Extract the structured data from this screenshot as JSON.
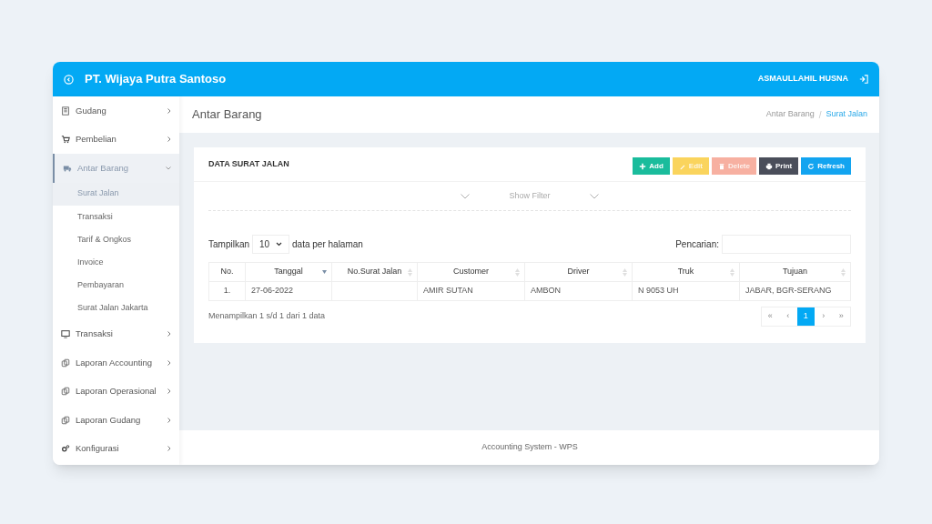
{
  "header": {
    "title": "PT. Wijaya Putra Santoso",
    "user": "ASMAULLAHIL HUSNA"
  },
  "sidebar": {
    "items": [
      {
        "label": "Gudang",
        "expanded": false,
        "selected": false
      },
      {
        "label": "Pembelian",
        "expanded": false,
        "selected": false
      },
      {
        "label": "Antar Barang",
        "expanded": true,
        "selected": true,
        "children": [
          {
            "label": "Surat Jalan",
            "selected": true
          },
          {
            "label": "Transaksi",
            "selected": false
          },
          {
            "label": "Tarif & Ongkos",
            "selected": false
          },
          {
            "label": "Invoice",
            "selected": false
          },
          {
            "label": "Pembayaran",
            "selected": false
          },
          {
            "label": "Surat Jalan Jakarta",
            "selected": false
          }
        ]
      },
      {
        "label": "Transaksi",
        "expanded": false,
        "selected": false
      },
      {
        "label": "Laporan Accounting",
        "expanded": false,
        "selected": false
      },
      {
        "label": "Laporan Operasional",
        "expanded": false,
        "selected": false
      },
      {
        "label": "Laporan Gudang",
        "expanded": false,
        "selected": false
      },
      {
        "label": "Konfigurasi",
        "expanded": false,
        "selected": false
      }
    ]
  },
  "page": {
    "title": "Antar Barang",
    "separator": "/",
    "breadcrumb": [
      {
        "label": "Antar Barang",
        "current": false
      },
      {
        "label": "Surat Jalan",
        "current": true
      }
    ]
  },
  "panel": {
    "title": "DATA SURAT JALAN",
    "buttons": [
      {
        "label": "Add",
        "kind": "add",
        "disabled": false
      },
      {
        "label": "Edit",
        "kind": "edit",
        "disabled": true
      },
      {
        "label": "Delete",
        "kind": "delete",
        "disabled": true
      },
      {
        "label": "Print",
        "kind": "print",
        "disabled": false
      },
      {
        "label": "Refresh",
        "kind": "refresh",
        "disabled": false
      }
    ],
    "filter_label": "Show Filter",
    "length": {
      "prefix": "Tampilkan",
      "value": "10",
      "suffix": "data per halaman"
    },
    "search": {
      "label": "Pencarian:"
    },
    "table": {
      "columns": [
        {
          "label": "No.",
          "sortable": false,
          "sorted": false
        },
        {
          "label": "Tanggal",
          "sortable": true,
          "sorted": true
        },
        {
          "label": "No.Surat Jalan",
          "sortable": true,
          "sorted": false
        },
        {
          "label": "Customer",
          "sortable": true,
          "sorted": false
        },
        {
          "label": "Driver",
          "sortable": true,
          "sorted": false
        },
        {
          "label": "Truk",
          "sortable": true,
          "sorted": false
        },
        {
          "label": "Tujuan",
          "sortable": true,
          "sorted": false
        }
      ],
      "rows": [
        [
          "1.",
          "27-06-2022",
          "",
          "AMIR SUTAN",
          "AMBON",
          "N 9053 UH",
          "JABAR, BGR-SERANG"
        ]
      ]
    },
    "info": "Menampilkan 1 s/d 1 dari 1 data",
    "pagination": [
      {
        "label": "«",
        "selected": false
      },
      {
        "label": "‹",
        "selected": false
      },
      {
        "label": "1",
        "selected": true
      },
      {
        "label": "›",
        "selected": false
      },
      {
        "label": "»",
        "selected": false
      }
    ]
  },
  "footer": "Accounting System - WPS"
}
